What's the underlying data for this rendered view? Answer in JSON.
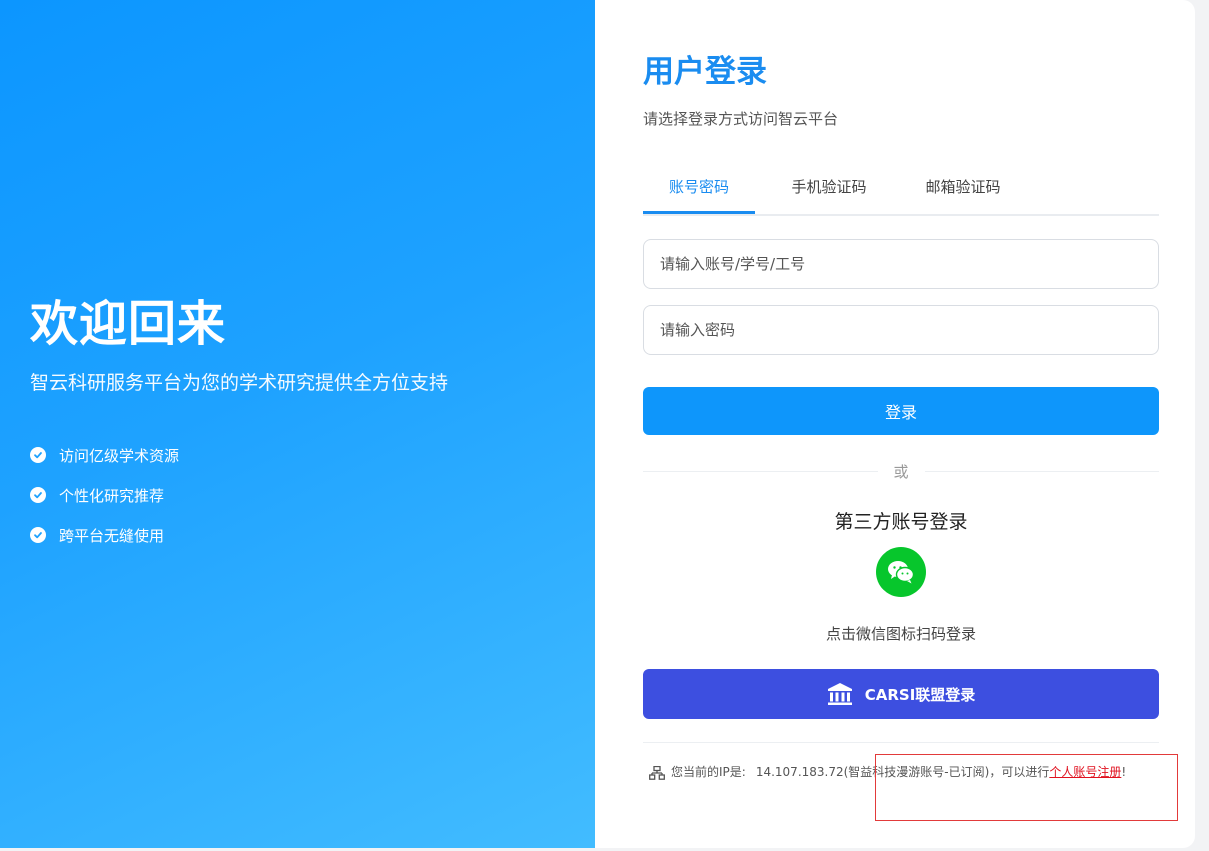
{
  "hero": {
    "title": "欢迎回来",
    "subtitle": "智云科研服务平台为您的学术研究提供全方位支持",
    "features": [
      "访问亿级学术资源",
      "个性化研究推荐",
      "跨平台无缝使用"
    ]
  },
  "login": {
    "title": "用户登录",
    "subtitle": "请选择登录方式访问智云平台",
    "tabs": [
      "账号密码",
      "手机验证码",
      "邮箱验证码"
    ],
    "active_tab": "账号密码",
    "username_placeholder": "请输入账号/学号/工号",
    "password_placeholder": "请输入密码",
    "login_button": "登录",
    "divider_text": "或",
    "third_party_title": "第三方账号登录",
    "wechat_hint": "点击微信图标扫码登录",
    "carsi_button": "CARSI联盟登录"
  },
  "footer": {
    "ip_label": "您当前的IP是:",
    "ip_info": "14.107.183.72(智益科技漫游账号-已订阅)，可以进行",
    "register_link": "个人账号注册",
    "suffix": "!"
  },
  "colors": {
    "brand": "#1a8cf0",
    "login_button": "#0e96fb",
    "carsi_button": "#3d4fe0",
    "wechat": "#07c62c",
    "register_link": "#e0101e"
  },
  "icons": [
    "check-icon",
    "wechat-icon",
    "bank-icon",
    "network-icon"
  ]
}
